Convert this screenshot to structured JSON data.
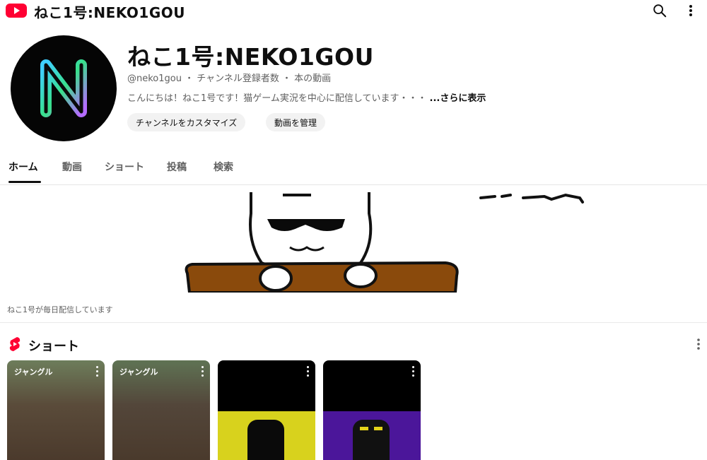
{
  "app": {
    "title": "ねこ1号:NEKO1GOU"
  },
  "channel": {
    "name": "ねこ1号:NEKO1GOU",
    "meta": "@neko1gou ・ チャンネル登録者数 ・ 本の動画",
    "description": "こんにちは！ねこ1号です！猫ゲーム実況を中心に配信しています・・・",
    "description_more": "...さらに表示",
    "avatar_letter": "N"
  },
  "buttons": {
    "customize": "チャンネルをカスタマイズ",
    "manage": "動画を管理"
  },
  "tabs": [
    {
      "label": "ホーム",
      "active": true
    },
    {
      "label": "動画",
      "active": false
    },
    {
      "label": "ショート",
      "active": false
    },
    {
      "label": "投稿",
      "active": false
    },
    {
      "label": "検索",
      "active": false
    }
  ],
  "banner": {
    "caption": "ねこ1号が毎日配信しています"
  },
  "shorts": {
    "title": "ショート",
    "cards": [
      {
        "overlay_text": "ジャングル"
      },
      {
        "overlay_text": "ジャングル"
      },
      {
        "overlay_text": ""
      },
      {
        "overlay_text": ""
      }
    ]
  },
  "colors": {
    "brand_red": "#ff0033",
    "text_primary": "#0f0f0f",
    "text_secondary": "#606060",
    "chip_bg": "#f2f2f2",
    "yellow": "#d8d21d",
    "purple": "#4b169a"
  },
  "icons": {
    "logo": "youtube-logo-icon",
    "search": "search-icon",
    "more": "more-vert-icon",
    "shorts": "shorts-icon"
  }
}
